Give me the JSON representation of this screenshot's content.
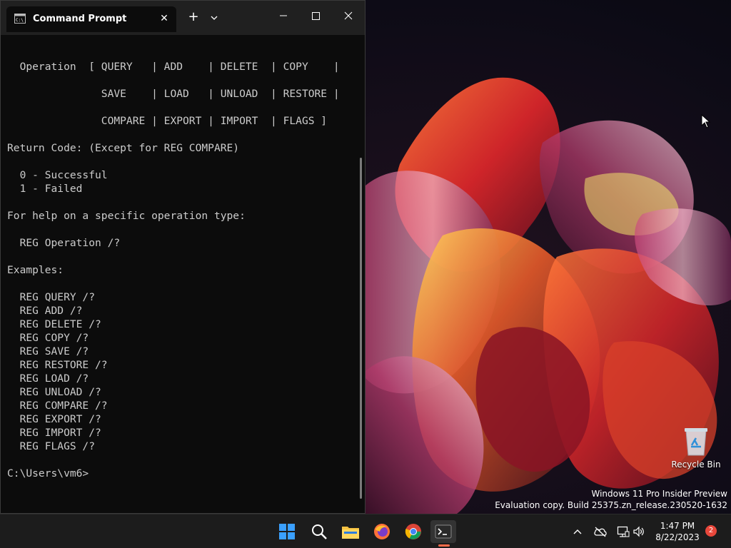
{
  "window": {
    "tab_title": "Command Prompt",
    "new_tab_symbol": "+",
    "close_tab_symbol": "✕"
  },
  "console": {
    "lines": [
      "",
      "  Operation  [ QUERY   | ADD    | DELETE  | COPY    |",
      "",
      "               SAVE    | LOAD   | UNLOAD  | RESTORE |",
      "",
      "               COMPARE | EXPORT | IMPORT  | FLAGS ]",
      "",
      "Return Code: (Except for REG COMPARE)",
      "",
      "  0 - Successful",
      "  1 - Failed",
      "",
      "For help on a specific operation type:",
      "",
      "  REG Operation /?",
      "",
      "Examples:",
      "",
      "  REG QUERY /?",
      "  REG ADD /?",
      "  REG DELETE /?",
      "  REG COPY /?",
      "  REG SAVE /?",
      "  REG RESTORE /?",
      "  REG LOAD /?",
      "  REG UNLOAD /?",
      "  REG COMPARE /?",
      "  REG EXPORT /?",
      "  REG IMPORT /?",
      "  REG FLAGS /?",
      "",
      "C:\\Users\\vm6>"
    ]
  },
  "desktop": {
    "recycle_bin_label": "Recycle Bin",
    "watermark_line1": "Windows 11 Pro Insider Preview",
    "watermark_line2": "Evaluation copy. Build 25375.zn_release.230520-1632"
  },
  "taskbar": {
    "apps": [
      "start-icon",
      "search-icon",
      "file-explorer-icon",
      "firefox-icon",
      "chrome-icon",
      "terminal-icon"
    ],
    "tray": [
      "chevron-up-icon",
      "cloud-offline-icon",
      "network-icon",
      "volume-icon"
    ],
    "time": "1:47 PM",
    "date": "8/22/2023",
    "notification_count": "2"
  },
  "colors": {
    "console_bg": "#0c0c0c",
    "console_text": "#cccccc",
    "titlebar_bg": "#202020",
    "taskbar_bg": "#1c1c1c",
    "accent": "#ff6b4a",
    "badge": "#e8473b"
  }
}
